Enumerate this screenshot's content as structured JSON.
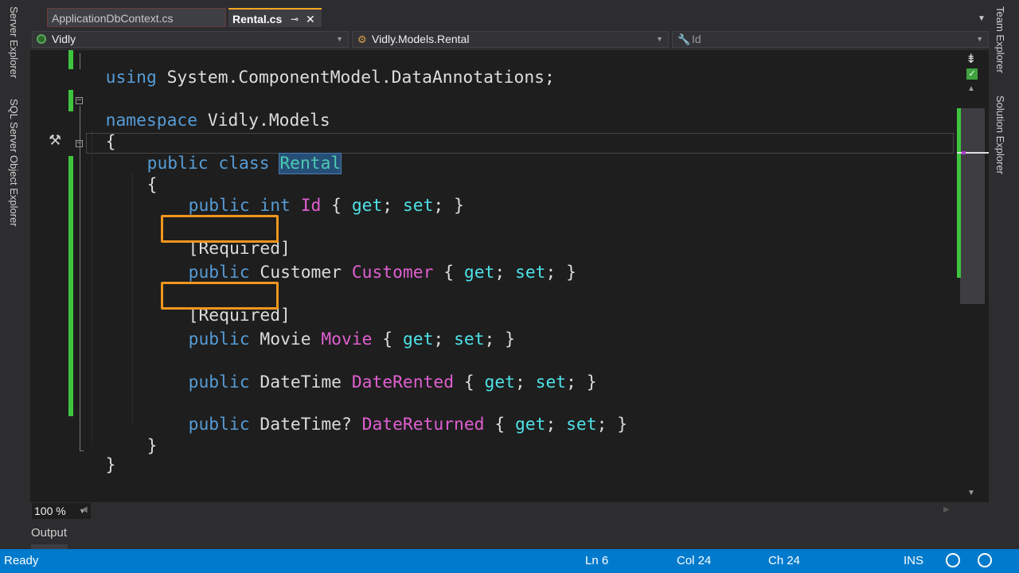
{
  "side_panels": {
    "left": [
      "Server Explorer",
      "SQL Server Object Explorer"
    ],
    "right": [
      "Team Explorer",
      "Solution Explorer"
    ]
  },
  "tabs": [
    {
      "label": "ApplicationDbContext.cs",
      "active": false
    },
    {
      "label": "Rental.cs",
      "active": true,
      "pin_glyph": "⊸",
      "close_glyph": "✕"
    }
  ],
  "navbar": {
    "project": "Vidly",
    "type": "Vidly.Models.Rental",
    "member": "Id"
  },
  "code": {
    "line1_kw": "using",
    "line1_ns": " System.ComponentModel.DataAnnotations;",
    "line3_kw": "namespace",
    "line3_ns": " Vidly.Models",
    "brace_open": "{",
    "line5_kw": "public class ",
    "line5_name": "Rental",
    "class_brace_open": "{",
    "p1_kw": "public int ",
    "p1_name": "Id",
    "accessors_open": " { ",
    "get": "get",
    "sep": "; ",
    "set": "set",
    "accessors_close": "; }",
    "attr1": "[Required]",
    "p2_kw": "public ",
    "p2_type": "Customer ",
    "p2_name": "Customer",
    "attr2": "[Required]",
    "p3_kw": "public ",
    "p3_type": "Movie ",
    "p3_name": "Movie",
    "p4_kw": "public ",
    "p4_type": "DateTime ",
    "p4_name": "DateRented",
    "p5_kw": "public ",
    "p5_type": "DateTime? ",
    "p5_name": "DateReturned",
    "class_brace_close": "}",
    "brace_close": "}"
  },
  "zoom": {
    "value": "100 %"
  },
  "output_label": "Output",
  "status": {
    "state": "Ready",
    "ln": "Ln 6",
    "col": "Col 24",
    "ch": "Ch 24",
    "mode": "INS"
  },
  "colors": {
    "status_bar": "#007acc",
    "change_bar": "#3fc43f",
    "highlight_box": "#f0961e",
    "selection": "#264f78"
  }
}
